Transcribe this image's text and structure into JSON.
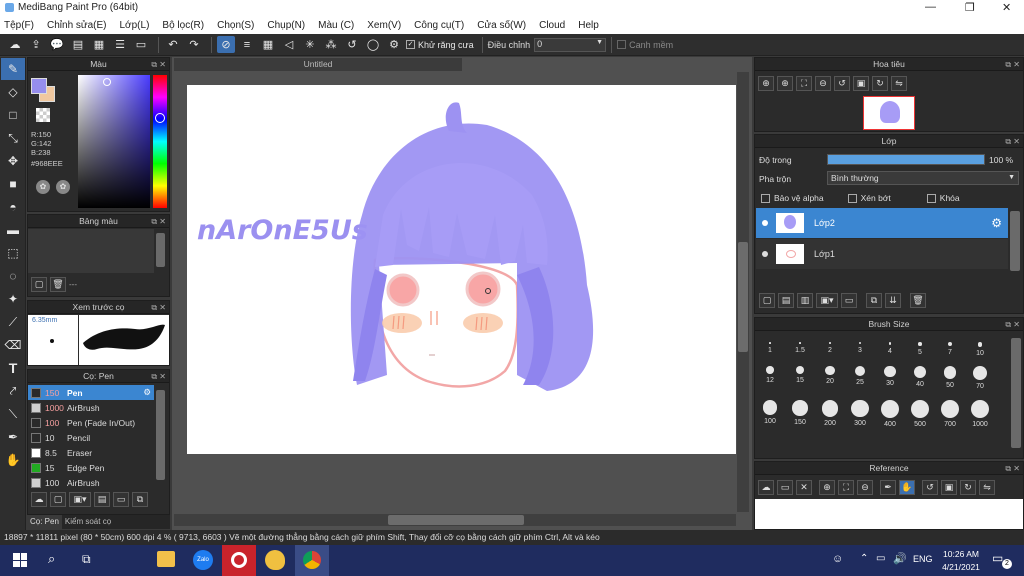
{
  "window": {
    "title": "MediBang Paint Pro (64bit)",
    "minimize": "—",
    "maximize": "❐",
    "close": "✕"
  },
  "menu": [
    "Tệp(F)",
    "Chỉnh sửa(E)",
    "Lớp(L)",
    "Bộ lọc(R)",
    "Chọn(S)",
    "Chụp(N)",
    "Màu (C)",
    "Xem(V)",
    "Công cụ(T)",
    "Cửa số(W)",
    "Cloud",
    "Help"
  ],
  "toolbar": {
    "antialias_label": "Khử răng cưa",
    "correction_label": "Điều chỉnh",
    "correction_value": "0",
    "snap_label": "Canh mềm"
  },
  "color_panel": {
    "title": "Màu",
    "r": "R:150",
    "g": "G:142",
    "b": "B:238",
    "hex": "#968EEE",
    "color": "#968EEE"
  },
  "palette_panel": {
    "title": "Bảng màu",
    "count": "---"
  },
  "brush_preview": {
    "title": "Xem trước cọ",
    "size": "6.35mm"
  },
  "brush_panel": {
    "title": "Cọ: Pen",
    "items": [
      {
        "size": "150",
        "name": "Pen",
        "color": "#2a2a2a"
      },
      {
        "size": "1000",
        "name": "AirBrush",
        "color": "#d0d0d0"
      },
      {
        "size": "100",
        "name": "Pen (Fade In/Out)",
        "color": "#2a2a2a"
      },
      {
        "size": "10",
        "name": "Pencil",
        "color": "#2a2a2a"
      },
      {
        "size": "8.5",
        "name": "Eraser",
        "color": "#ffffff"
      },
      {
        "size": "15",
        "name": "Edge Pen",
        "color": "#22aa22"
      },
      {
        "size": "100",
        "name": "AirBrush",
        "color": "#d0d0d0"
      }
    ]
  },
  "left_tabs": {
    "brush": "Cọ: Pen",
    "control": "Kiểm soát cọ"
  },
  "canvas": {
    "tab": "Untitled",
    "signature": "nArOnE5Us"
  },
  "navigator": {
    "title": "Hoa tiêu"
  },
  "layers": {
    "title": "Lớp",
    "opacity_label": "Độ trong",
    "opacity_value": "100 %",
    "opacity": 1.0,
    "blend_label": "Pha trộn",
    "blend_value": "Bình thường",
    "protect_alpha": "Bảo vệ alpha",
    "clipping": "Xén bớt",
    "lock": "Khóa",
    "items": [
      {
        "name": "Lớp2"
      },
      {
        "name": "Lớp1"
      }
    ]
  },
  "brush_size": {
    "title": "Brush Size",
    "sizes": [
      "1",
      "1.5",
      "2",
      "3",
      "4",
      "5",
      "7",
      "10",
      "12",
      "15",
      "20",
      "25",
      "30",
      "40",
      "50",
      "70",
      "100",
      "150",
      "200",
      "300",
      "400",
      "500",
      "700",
      "1000"
    ]
  },
  "reference": {
    "title": "Reference"
  },
  "status": {
    "text": "18897 * 11811 pixel  (80 * 50cm)  600 dpi  4 %  ( 9713, 6603 )  Vẽ một đường thẳng bằng cách giữ phím Shift, Thay đổi cỡ cọ bằng cách giữ phím Ctrl, Alt và kéo"
  },
  "taskbar": {
    "lang": "ENG",
    "time": "10:26 AM",
    "date": "4/21/2021",
    "notify": "2",
    "zalo": "Zalo"
  }
}
